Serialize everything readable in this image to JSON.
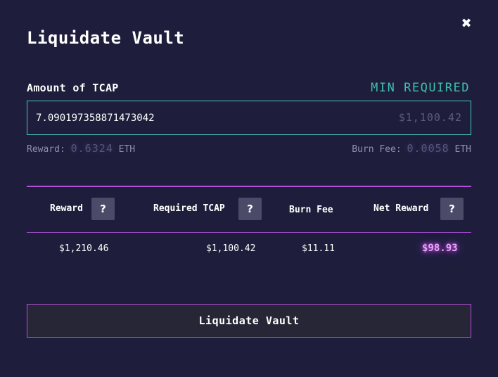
{
  "modal": {
    "title": "Liquidate Vault",
    "close_icon": "close-icon",
    "close_glyph": "✖"
  },
  "amount": {
    "label": "Amount of TCAP",
    "min_required_label": "MIN REQUIRED",
    "value": "7.090197358871473042",
    "usd_value": "$1,100.42"
  },
  "reward_meta": {
    "label": "Reward:",
    "value": "0.6324",
    "unit": "ETH"
  },
  "burn_fee_meta": {
    "label": "Burn Fee:",
    "value": "0.0058",
    "unit": "ETH"
  },
  "table": {
    "headers": {
      "reward": "Reward",
      "required_tcap": "Required TCAP",
      "burn_fee": "Burn Fee",
      "net_reward": "Net Reward"
    },
    "help_glyph": "?",
    "help_icon": "help-icon",
    "row": {
      "reward": "$1,210.46",
      "required_tcap": "$1,100.42",
      "burn_fee": "$11.11",
      "net_reward": "$98.93"
    }
  },
  "action": {
    "button_label": "Liquidate Vault"
  },
  "colors": {
    "background": "#1e1e3c",
    "accent_teal": "#45c7b7",
    "accent_purple": "#b34fd8",
    "net_reward_glow": "#c150e6"
  }
}
